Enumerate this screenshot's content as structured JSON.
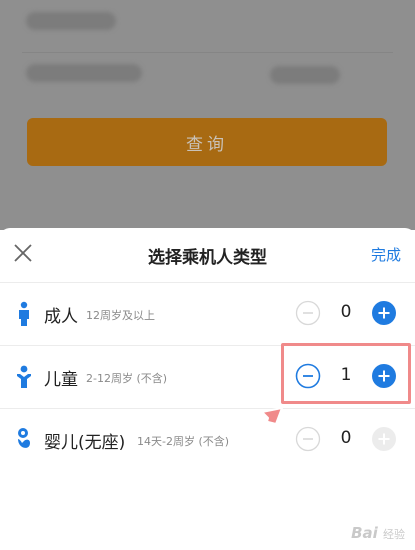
{
  "sheet": {
    "title": "选择乘机人类型",
    "done_label": "完成",
    "close_icon": "close-icon"
  },
  "background": {
    "query_label": "查询"
  },
  "passengers": [
    {
      "name": "成人",
      "age": "12周岁及以上",
      "count": "0",
      "icon": "adult-icon",
      "minus_enabled": false,
      "plus_enabled": true
    },
    {
      "name": "儿童",
      "age": "2-12周岁 (不含)",
      "count": "1",
      "icon": "child-icon",
      "minus_enabled": true,
      "plus_enabled": true
    },
    {
      "name": "婴儿(无座)",
      "age": "14天-2周岁 (不含)",
      "count": "0",
      "icon": "infant-icon",
      "minus_enabled": false,
      "plus_enabled": false
    }
  ],
  "colors": {
    "accent": "#1f7be0",
    "disabled": "#d8d8d8",
    "query_button": "#a86a12",
    "annotation": "#f08a8a"
  },
  "watermark": {
    "brand": "Bai",
    "suffix": "经验"
  }
}
